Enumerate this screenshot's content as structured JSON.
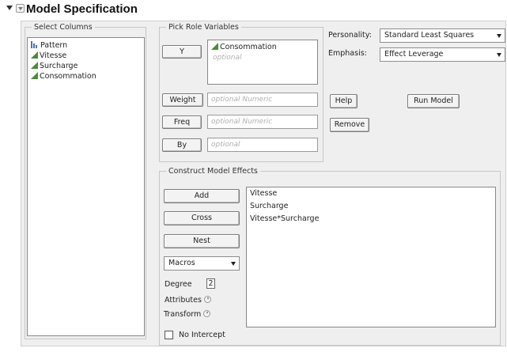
{
  "header": {
    "title": "Model Specification"
  },
  "select_columns": {
    "legend": "Select Columns",
    "items": [
      {
        "label": "Pattern",
        "type": "nominal",
        "icon": "nominal-bars-icon"
      },
      {
        "label": "Vitesse",
        "type": "continuous",
        "icon": "continuous-triangle-icon"
      },
      {
        "label": "Surcharge",
        "type": "continuous",
        "icon": "continuous-triangle-icon"
      },
      {
        "label": "Consommation",
        "type": "continuous",
        "icon": "continuous-triangle-icon"
      }
    ]
  },
  "pick_role": {
    "legend": "Pick Role Variables",
    "y_button": "Y",
    "y_value": "Consommation",
    "y_optional": "optional",
    "weight_button": "Weight",
    "weight_placeholder": "optional Numeric",
    "freq_button": "Freq",
    "freq_placeholder": "optional Numeric",
    "by_button": "By",
    "by_placeholder": "optional"
  },
  "settings": {
    "personality_label": "Personality:",
    "personality_value": "Standard Least Squares",
    "emphasis_label": "Emphasis:",
    "emphasis_value": "Effect Leverage"
  },
  "actions": {
    "help": "Help",
    "run_model": "Run Model",
    "remove": "Remove"
  },
  "construct": {
    "legend": "Construct Model Effects",
    "add": "Add",
    "cross": "Cross",
    "nest": "Nest",
    "macros": "Macros",
    "degree_label": "Degree",
    "degree_value": "2",
    "attributes_label": "Attributes",
    "transform_label": "Transform",
    "no_intercept_label": "No Intercept",
    "no_intercept_checked": false,
    "effects": [
      "Vitesse",
      "Surcharge",
      "Vitesse*Surcharge"
    ]
  },
  "colors": {
    "panel_bg": "#efefef",
    "nominal_icon": "#4a76b0",
    "continuous_icon": "#4a8c3c"
  }
}
